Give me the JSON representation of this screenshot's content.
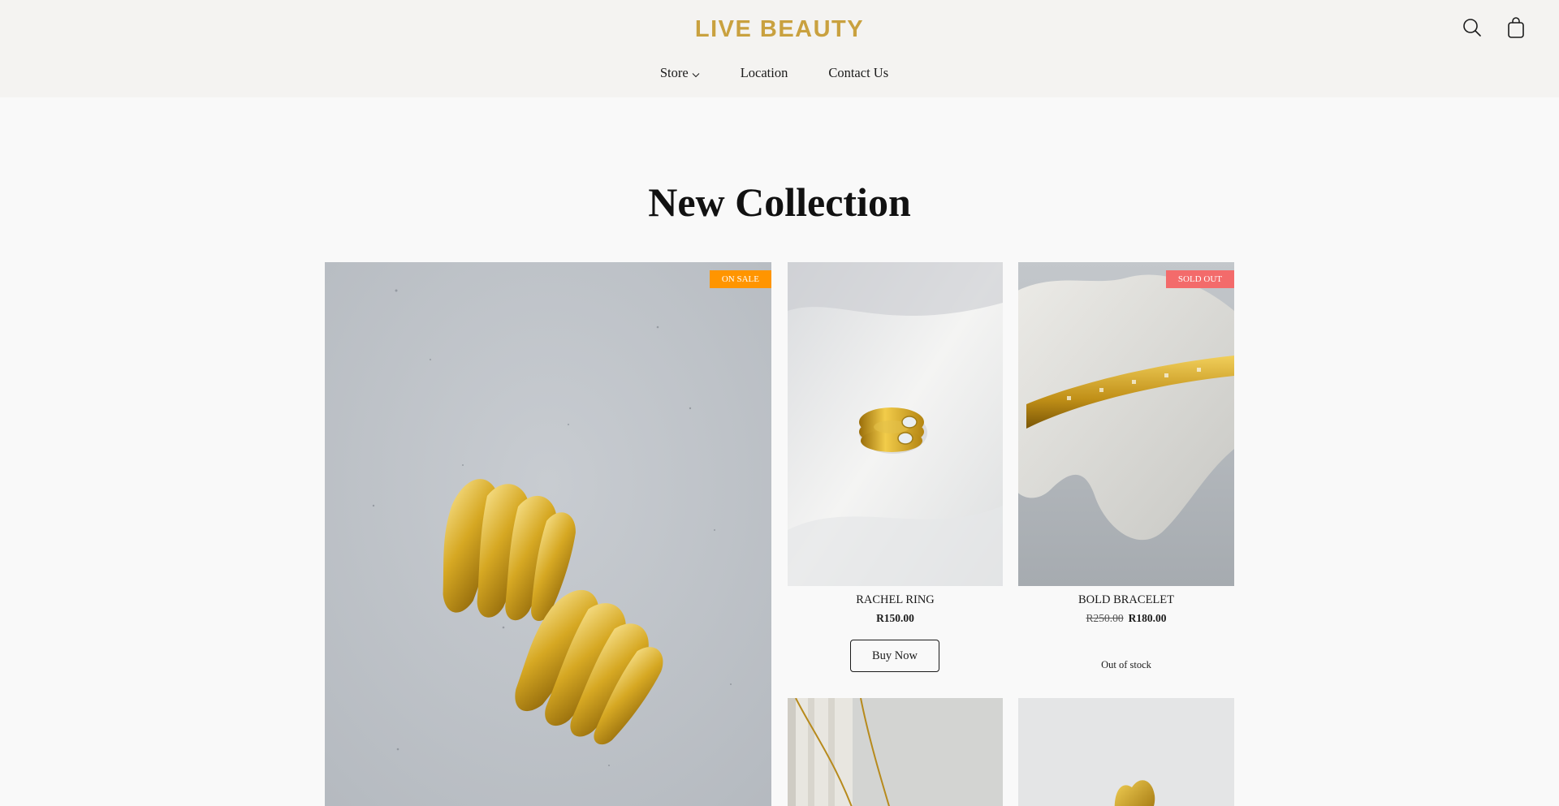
{
  "header": {
    "logo": "LIVE BEAUTY",
    "nav": [
      {
        "label": "Store",
        "has_dropdown": true
      },
      {
        "label": "Location"
      },
      {
        "label": "Contact Us"
      }
    ],
    "icons": [
      "search-icon",
      "shopping-bag-icon"
    ]
  },
  "section": {
    "title": "New Collection"
  },
  "products": {
    "featured": {
      "badge": "ON SALE"
    },
    "ring": {
      "name": "RACHEL RING",
      "price": "R150.00",
      "button": "Buy Now"
    },
    "bracelet": {
      "name": "BOLD BRACELET",
      "old_price": "R250.00",
      "price": "R180.00",
      "badge": "SOLD OUT",
      "status": "Out of stock"
    }
  },
  "colors": {
    "brand": "#c9a13f",
    "header_bg": "#f4f3f1",
    "sale_badge": "#ff9500",
    "sold_badge": "#f36b6b"
  }
}
